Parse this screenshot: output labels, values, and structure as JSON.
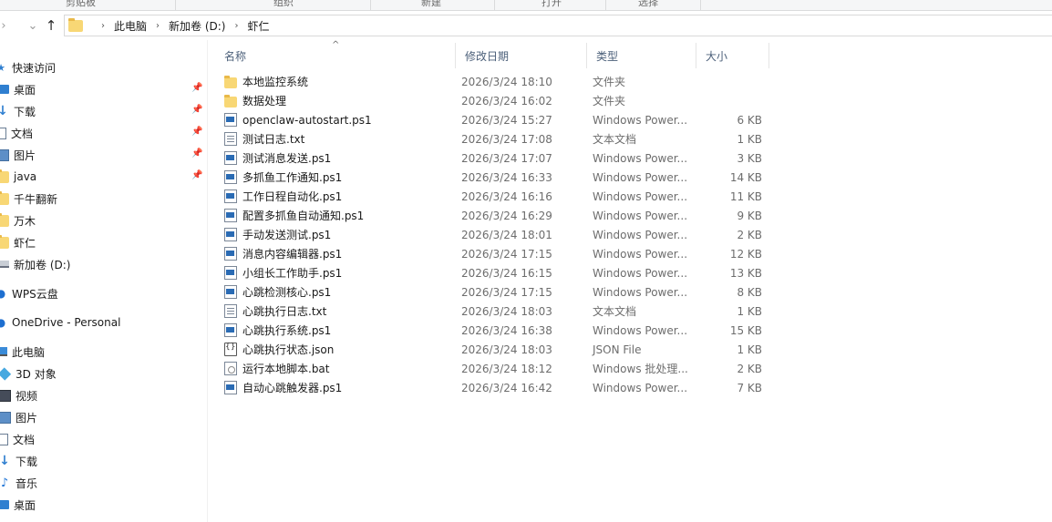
{
  "ribbon": {
    "groups": [
      "剪贴板",
      "组织",
      "新建",
      "打开",
      "选择"
    ]
  },
  "nav": {
    "back_icon": "arrow-left-icon",
    "forward_icon": "arrow-right-icon",
    "recent_icon": "chevron-down-icon",
    "up_icon": "arrow-up-icon"
  },
  "address": {
    "crumbs": [
      "此电脑",
      "新加卷 (D:)",
      "虾仁"
    ]
  },
  "sidebar": {
    "quick_access": {
      "label": "快速访问",
      "items": [
        {
          "label": "桌面",
          "icon": "desktop-icon",
          "pinned": true
        },
        {
          "label": "下载",
          "icon": "download-icon",
          "pinned": true
        },
        {
          "label": "文档",
          "icon": "documents-icon",
          "pinned": true
        },
        {
          "label": "图片",
          "icon": "pictures-icon",
          "pinned": true
        },
        {
          "label": "java",
          "icon": "folder-icon",
          "pinned": true
        },
        {
          "label": "千牛翻新",
          "icon": "folder-icon",
          "pinned": false
        },
        {
          "label": "万木",
          "icon": "folder-icon",
          "pinned": false
        },
        {
          "label": "虾仁",
          "icon": "folder-icon",
          "pinned": false
        },
        {
          "label": "新加卷 (D:)",
          "icon": "drive-icon",
          "pinned": false
        }
      ]
    },
    "wps": {
      "label": "WPS云盘"
    },
    "onedrive": {
      "label": "OneDrive - Personal"
    },
    "this_pc": {
      "label": "此电脑",
      "items": [
        {
          "label": "3D 对象",
          "icon": "3d-objects-icon"
        },
        {
          "label": "视频",
          "icon": "videos-icon"
        },
        {
          "label": "图片",
          "icon": "pictures-icon"
        },
        {
          "label": "文档",
          "icon": "documents-icon"
        },
        {
          "label": "下载",
          "icon": "download-icon"
        },
        {
          "label": "音乐",
          "icon": "music-icon"
        },
        {
          "label": "桌面",
          "icon": "desktop-icon"
        }
      ]
    }
  },
  "columns": {
    "name": "名称",
    "date": "修改日期",
    "type": "类型",
    "size": "大小"
  },
  "files": [
    {
      "name": "本地监控系统",
      "date": "2026/3/24 18:10",
      "type": "文件夹",
      "size": "",
      "icon": "folder-icon"
    },
    {
      "name": "数据处理",
      "date": "2026/3/24 16:02",
      "type": "文件夹",
      "size": "",
      "icon": "folder-icon"
    },
    {
      "name": "openclaw-autostart.ps1",
      "date": "2026/3/24 15:27",
      "type": "Windows Power...",
      "size": "6 KB",
      "icon": "ps1-file-icon"
    },
    {
      "name": "测试日志.txt",
      "date": "2026/3/24 17:08",
      "type": "文本文档",
      "size": "1 KB",
      "icon": "text-file-icon"
    },
    {
      "name": "测试消息发送.ps1",
      "date": "2026/3/24 17:07",
      "type": "Windows Power...",
      "size": "3 KB",
      "icon": "ps1-file-icon"
    },
    {
      "name": "多抓鱼工作通知.ps1",
      "date": "2026/3/24 16:33",
      "type": "Windows Power...",
      "size": "14 KB",
      "icon": "ps1-file-icon"
    },
    {
      "name": "工作日程自动化.ps1",
      "date": "2026/3/24 16:16",
      "type": "Windows Power...",
      "size": "11 KB",
      "icon": "ps1-file-icon"
    },
    {
      "name": "配置多抓鱼自动通知.ps1",
      "date": "2026/3/24 16:29",
      "type": "Windows Power...",
      "size": "9 KB",
      "icon": "ps1-file-icon"
    },
    {
      "name": "手动发送测试.ps1",
      "date": "2026/3/24 18:01",
      "type": "Windows Power...",
      "size": "2 KB",
      "icon": "ps1-file-icon"
    },
    {
      "name": "消息内容编辑器.ps1",
      "date": "2026/3/24 17:15",
      "type": "Windows Power...",
      "size": "12 KB",
      "icon": "ps1-file-icon"
    },
    {
      "name": "小组长工作助手.ps1",
      "date": "2026/3/24 16:15",
      "type": "Windows Power...",
      "size": "13 KB",
      "icon": "ps1-file-icon"
    },
    {
      "name": "心跳检测核心.ps1",
      "date": "2026/3/24 17:15",
      "type": "Windows Power...",
      "size": "8 KB",
      "icon": "ps1-file-icon"
    },
    {
      "name": "心跳执行日志.txt",
      "date": "2026/3/24 18:03",
      "type": "文本文档",
      "size": "1 KB",
      "icon": "text-file-icon"
    },
    {
      "name": "心跳执行系统.ps1",
      "date": "2026/3/24 16:38",
      "type": "Windows Power...",
      "size": "15 KB",
      "icon": "ps1-file-icon"
    },
    {
      "name": "心跳执行状态.json",
      "date": "2026/3/24 18:03",
      "type": "JSON File",
      "size": "1 KB",
      "icon": "json-file-icon"
    },
    {
      "name": "运行本地脚本.bat",
      "date": "2026/3/24 18:12",
      "type": "Windows 批处理...",
      "size": "2 KB",
      "icon": "bat-file-icon"
    },
    {
      "name": "自动心跳触发器.ps1",
      "date": "2026/3/24 16:42",
      "type": "Windows Power...",
      "size": "7 KB",
      "icon": "ps1-file-icon"
    }
  ]
}
